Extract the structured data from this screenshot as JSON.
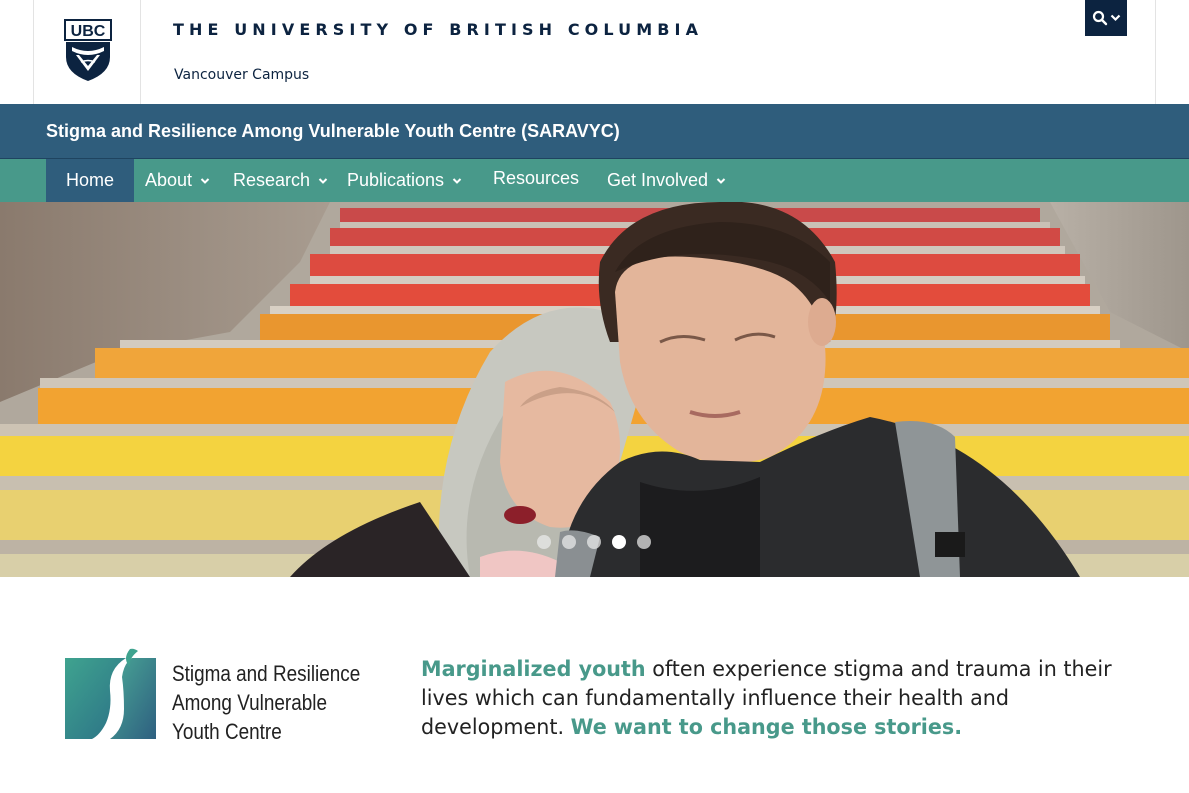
{
  "header": {
    "university": "THE UNIVERSITY OF BRITISH COLUMBIA",
    "campus": "Vancouver Campus",
    "logo_text": "UBC",
    "logo_icon": "ubc-crest-icon",
    "search_icon": "search-icon",
    "search_caret_icon": "chevron-down-icon"
  },
  "unit": {
    "name": "Stigma and Resilience Among Vulnerable Youth Centre (SARAVYC)"
  },
  "nav": {
    "items": [
      {
        "label": "Home",
        "dropdown": false,
        "active": true
      },
      {
        "label": "About",
        "dropdown": true,
        "active": false
      },
      {
        "label": "Research",
        "dropdown": true,
        "active": false
      },
      {
        "label": "Publications",
        "dropdown": true,
        "active": false
      },
      {
        "label": "Resources",
        "dropdown": false,
        "active": false
      },
      {
        "label": "Get Involved",
        "dropdown": true,
        "active": false
      }
    ],
    "caret_glyph": "⌄"
  },
  "carousel": {
    "slide_count": 5,
    "active_index": 3
  },
  "intro": {
    "logo_lines": [
      "Stigma and Resilience",
      "Among Vulnerable",
      "Youth Centre"
    ],
    "highlight_1": "Marginalized youth",
    "text_1": " often experience stigma and trauma in their lives which can fundamentally influence their health and development. ",
    "highlight_2": "We want to change those stories."
  },
  "colors": {
    "ubc_navy": "#0c2340",
    "unit_bar": "#2f5d7c",
    "nav_teal": "#48998a",
    "nav_active": "#2f5d7c",
    "highlight": "#48998a"
  }
}
